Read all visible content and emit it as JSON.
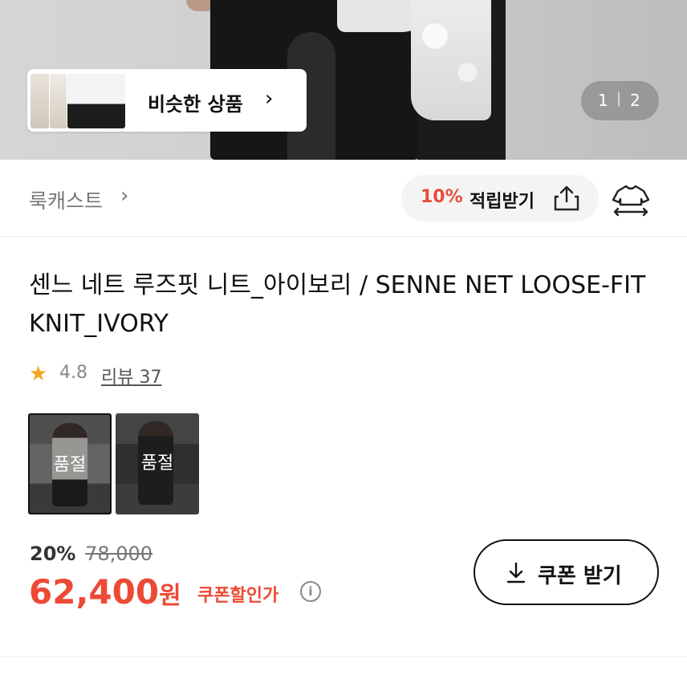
{
  "hero": {
    "similar_label": "비슷한 상품",
    "pager": {
      "current": "1",
      "separator": "|",
      "total": "2"
    }
  },
  "brand": {
    "name": "룩캐스트"
  },
  "reward": {
    "percent": "10%",
    "label": "적립받기"
  },
  "product": {
    "title": "센느 네트 루즈핏 니트_아이보리 / SENNE NET LOOSE-FIT KNIT_IVORY",
    "rating": "4.8",
    "review_label": "리뷰 37",
    "options": [
      {
        "status": "품절"
      },
      {
        "status": "품절"
      }
    ]
  },
  "pricing": {
    "discount_rate": "20%",
    "original_price": "78,000",
    "sale_price": "62,400",
    "currency": "원",
    "coupon_price_label": "쿠폰할인가",
    "coupon_button_label": "쿠폰 받기"
  },
  "colors": {
    "accent": "#ec4a35",
    "reward_accent": "#e94c3b",
    "star": "#f5a623"
  },
  "icons": [
    "chevron-right-icon",
    "share-icon",
    "hanger-icon",
    "star-icon",
    "info-icon",
    "download-icon"
  ]
}
